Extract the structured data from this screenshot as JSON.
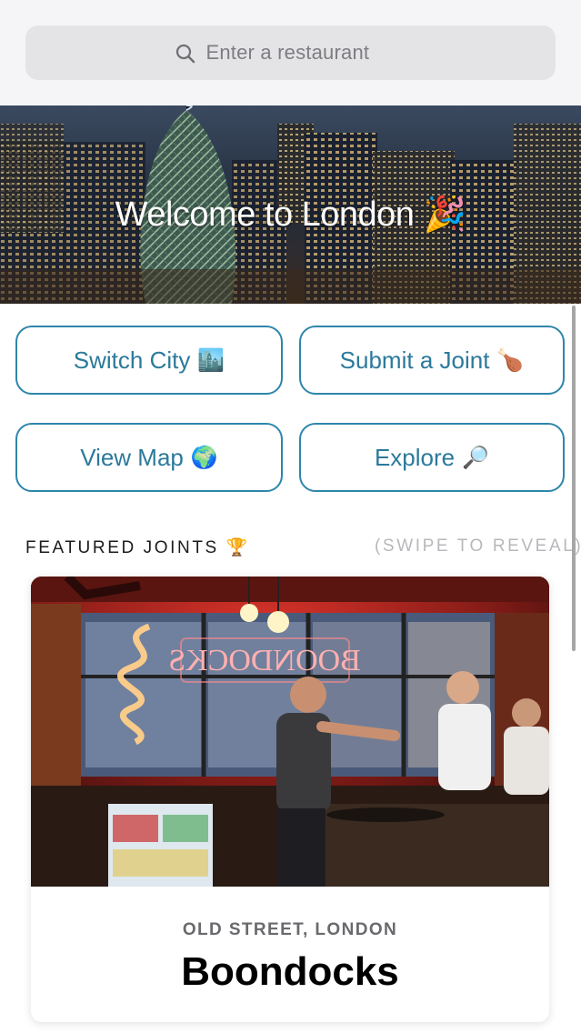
{
  "search": {
    "placeholder": "Enter a restaurant",
    "icon": "search-icon"
  },
  "hero": {
    "title": "Welcome to London 🎉"
  },
  "actions": [
    {
      "label": "Switch City",
      "emoji": "🏙️"
    },
    {
      "label": "Submit a Joint",
      "emoji": "🍗"
    },
    {
      "label": "View Map",
      "emoji": "🌍"
    },
    {
      "label": "Explore",
      "emoji": "🔎"
    }
  ],
  "featured": {
    "title": "FEATURED JOINTS 🏆",
    "hint": "(SWIPE TO REVEAL)",
    "card": {
      "location": "OLD STREET, LONDON",
      "name": "Boondocks",
      "sign_text": "BOONDOCKS"
    }
  },
  "colors": {
    "accent": "#2e86ab",
    "accent_text": "#2b7a9b",
    "search_bg": "#e4e4e7"
  }
}
